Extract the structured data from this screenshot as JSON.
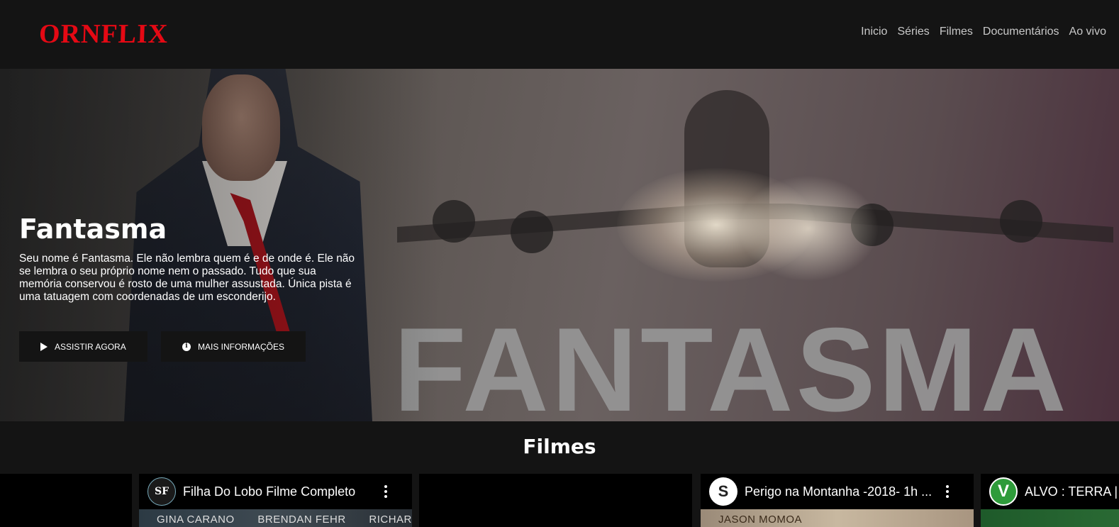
{
  "header": {
    "logo": "ORNFLIX",
    "nav": [
      "Inicio",
      "Séries",
      "Filmes",
      "Documentários",
      "Ao vivo"
    ]
  },
  "hero": {
    "title": "Fantasma",
    "description": "Seu nome é Fantasma. Ele não lembra quem é e de onde é. Ele não se lembra o seu próprio nome nem o passado. Tudo que sua memória conservou é rosto de uma mulher assustada. Única pista é uma tatuagem com coordenadas de um esconderijo.",
    "poster_text": "FANTASMA",
    "play_label": "ASSISTIR AGORA",
    "info_label": "MAIS INFORMAÇÕES",
    "play_icon": "play-icon",
    "info_icon": "info-icon"
  },
  "section": {
    "title": "Filmes"
  },
  "cards": [
    {
      "title": "",
      "avatar": ""
    },
    {
      "title": "Filha Do Lobo Filme Completo",
      "avatar": "SF",
      "credits": [
        "GINA CARANO",
        "BRENDAN FEHR",
        "RICHARD DREYFUSS"
      ]
    },
    {
      "title": "",
      "avatar": ""
    },
    {
      "title": "Perigo na Montanha -2018- 1h ...",
      "avatar": "S",
      "credits": [
        "JASON MOMOA"
      ]
    },
    {
      "title": "ALVO : TERRA |",
      "avatar": "V"
    }
  ],
  "colors": {
    "brand": "#e50914",
    "background": "#141414",
    "nav_text": "#c8c8c8"
  }
}
